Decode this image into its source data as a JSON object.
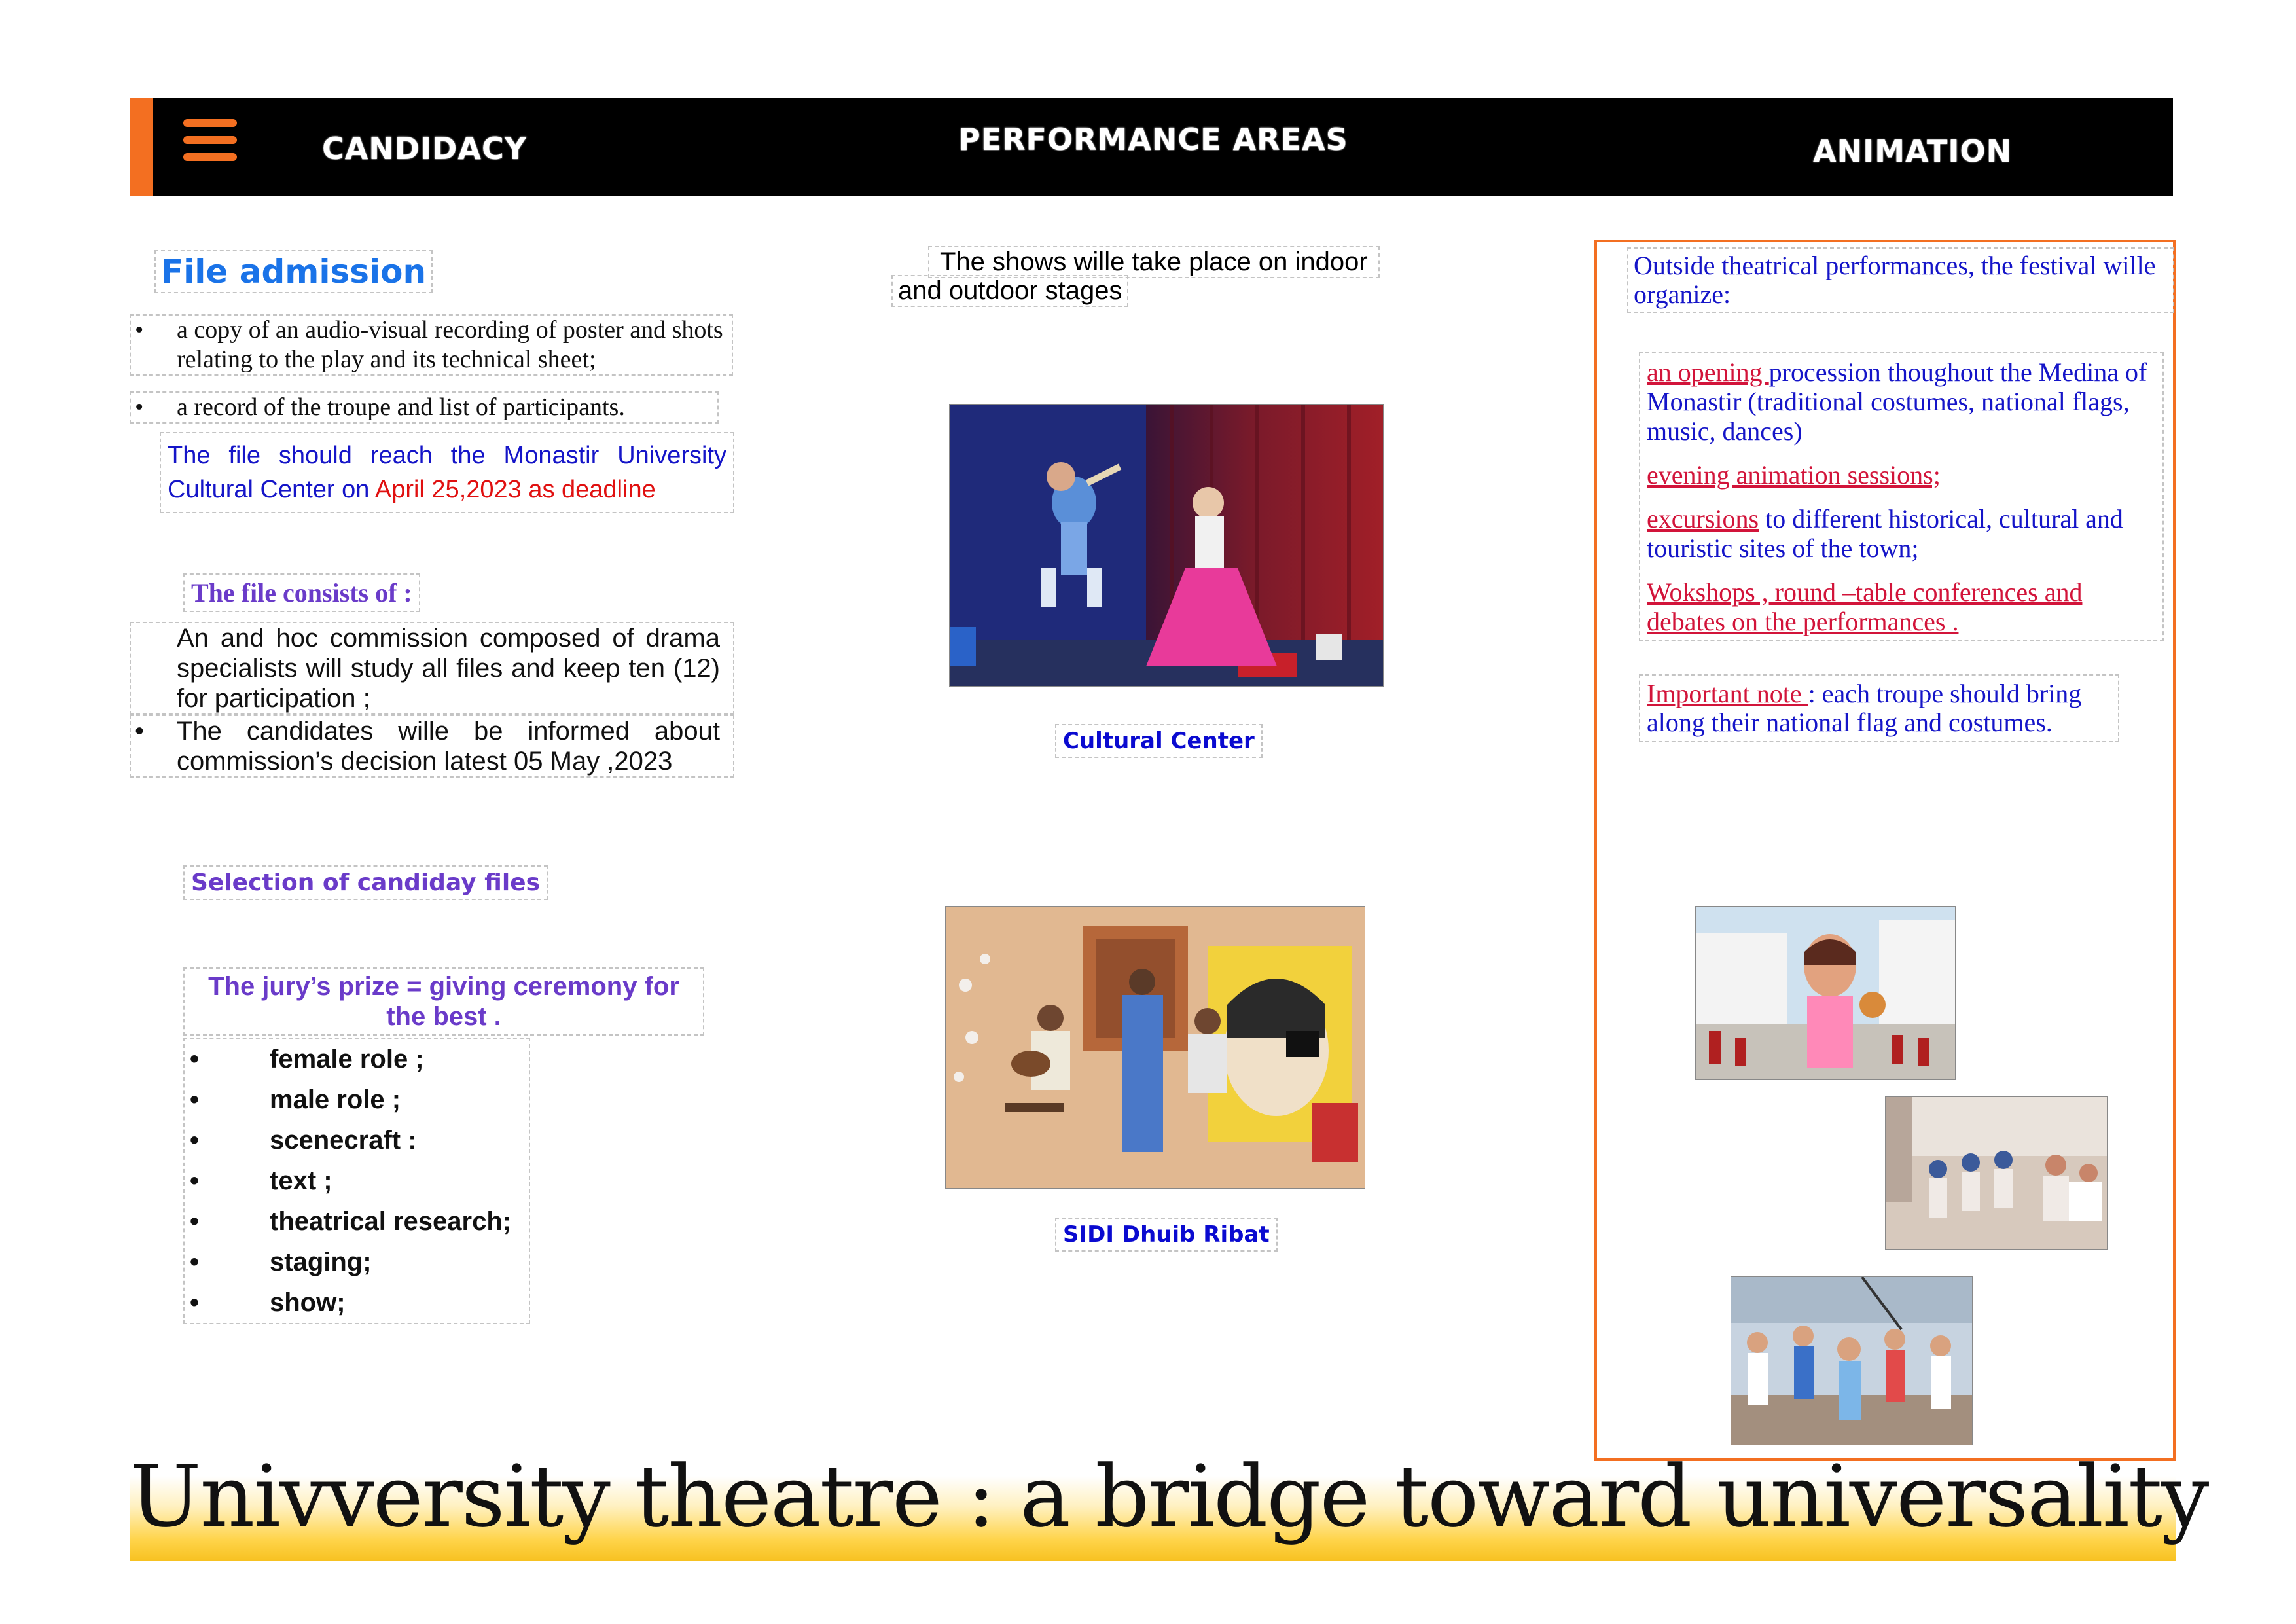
{
  "header": {
    "menu_icon": "hamburger-menu-icon",
    "nav": [
      "CANDIDACY",
      "PERFORMANCE AREAS",
      "ANIMATION"
    ],
    "accent_color": "#f36f21"
  },
  "candidacy": {
    "title": "File admission",
    "items": [
      "a copy of an audio-visual recording of poster and shots relating to the play and  its technical sheet;",
      "a record of the troupe and list of participants."
    ],
    "deadline_prefix": "The file should reach the Monastir University Cultural Center on ",
    "deadline_date": "April 25,2023  as deadline",
    "consists_title": "The file consists of  :",
    "consists_items": [
      "An and hoc commission composed of drama specialists will study all files and keep ten (12) for participation ;",
      "The candidates wille be informed about commission’s decision latest 05 May ,2023"
    ],
    "selection_title": "Selection of candiday files",
    "jury_title": "The jury’s prize = giving ceremony for the best .",
    "roles": [
      "female role ;",
      "male role ;",
      "scenecraft :",
      "text ;",
      "theatrical research;",
      "staging;",
      "show;"
    ]
  },
  "performance": {
    "intro_line1": "The shows wille take place on indoor",
    "intro_line2": "and outdoor stages",
    "venues": [
      "Cultural Center",
      "SIDI Dhuib Ribat"
    ]
  },
  "animation": {
    "intro": "Outside theatrical performances, the festival wille organize:",
    "item1_link": "an opening ",
    "item1_rest": "procession thoughout the Medina of Monastir (traditional costumes, national flags, music, dances)",
    "item2": "evening animation sessions;",
    "item3_link": "excursions",
    "item3_rest": " to different historical, cultural and touristic sites of the town;",
    "item4": "Wokshops , round –table conferences and debates on the performances .",
    "note_label": "Important note ",
    "note_text": ": each troupe should bring along their national flag and costumes."
  },
  "footer": {
    "slogan": "Univversity theatre : a bridge toward universality"
  }
}
